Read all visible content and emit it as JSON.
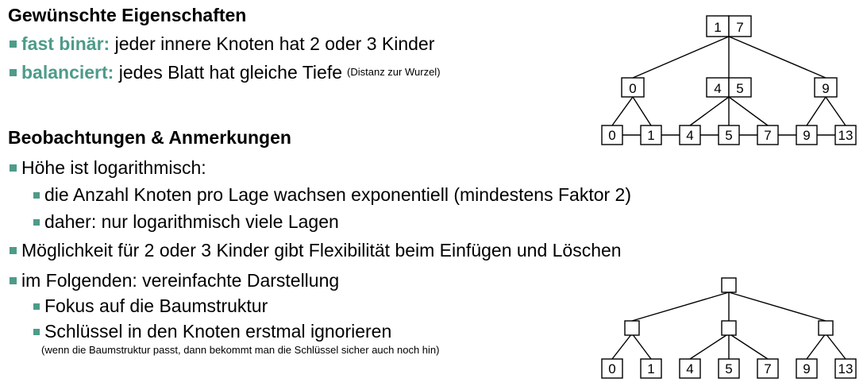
{
  "accent": "#4e9b8a",
  "section1": {
    "title": "Gewünschte Eigenschaften",
    "b1_kw": "fast binär:",
    "b1_text": "jeder innere Knoten hat 2 oder 3 Kinder",
    "b2_kw": "balanciert:",
    "b2_text": "jedes Blatt hat gleiche Tiefe",
    "b2_note": "(Distanz zur Wurzel)"
  },
  "section2": {
    "title": "Beobachtungen & Anmerkungen",
    "b1": "Höhe ist logarithmisch:",
    "b1_1": "die Anzahl Knoten pro Lage wachsen exponentiell (mindestens Faktor 2)",
    "b1_2": "daher: nur logarithmisch viele Lagen",
    "b2": "Möglichkeit für 2 oder 3 Kinder gibt Flexibilität beim Einfügen und Löschen",
    "b3": "im Folgenden: vereinfachte Darstellung",
    "b3_1": "Fokus auf die Baumstruktur",
    "b3_2": "Schlüssel in den Knoten erstmal ignorieren",
    "b3_note": "(wenn die Baumstruktur passt, dann bekommt man die Schlüssel sicher auch noch hin)"
  },
  "tree1": {
    "root_keys": [
      "1",
      "7"
    ],
    "inner_keys": [
      [
        "0"
      ],
      [
        "4",
        "5"
      ],
      [
        "9"
      ]
    ],
    "leaves": [
      "0",
      "1",
      "4",
      "5",
      "7",
      "9",
      "13"
    ]
  },
  "tree2": {
    "leaves": [
      "0",
      "1",
      "4",
      "5",
      "7",
      "9",
      "13"
    ]
  }
}
